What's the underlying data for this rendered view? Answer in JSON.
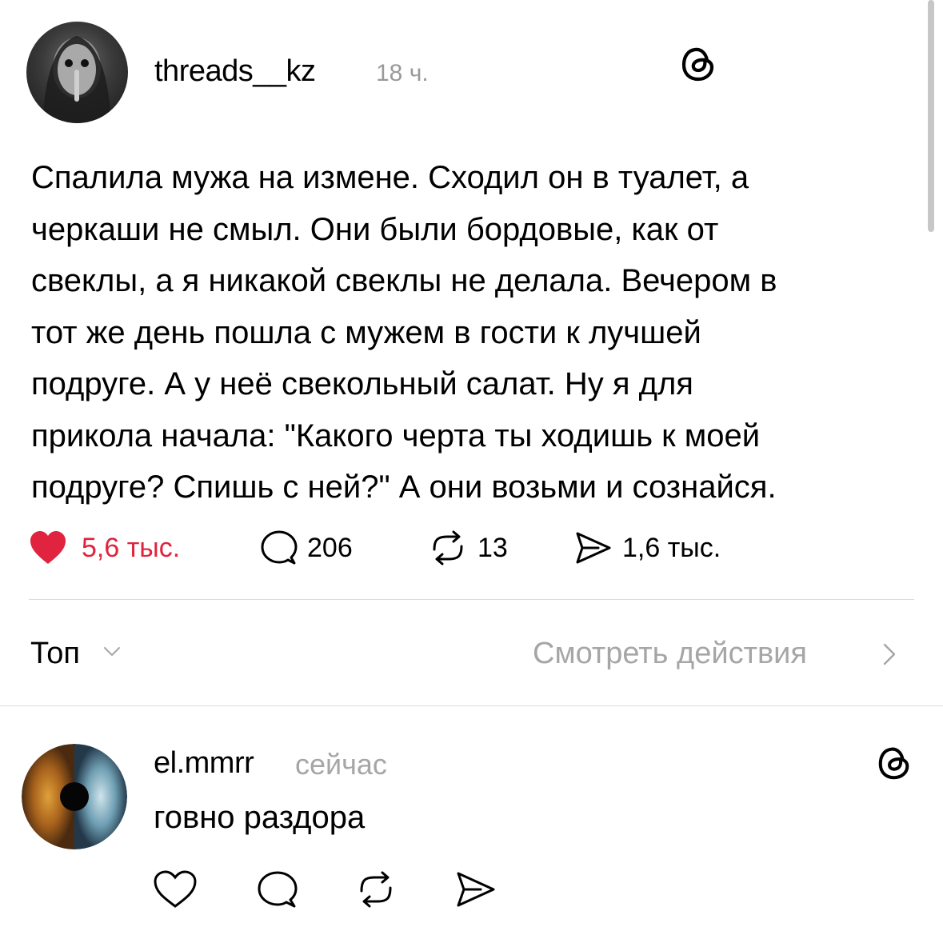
{
  "post": {
    "username": "threads__kz",
    "time": "18 ч.",
    "text": "Спалила мужа на измене. Сходил он в туалет, а\nчеркаши не смыл. Они были бордовые, как от\nсвеклы, а я никакой свеклы не делала. Вечером в\nтот же день пошла с мужем в гости к лучшей\nподруге. А у неё свекольный салат. Ну я для\nприкола начала: \"Какого черта ты ходишь к моей\nподруге? Спишь с ней?\" А они возьми и сознайся.",
    "likes": "5,6 тыс.",
    "replies": "206",
    "reposts": "13",
    "shares": "1,6 тыс.",
    "liked": true,
    "like_color": "#e0233e"
  },
  "sort": {
    "label": "Топ",
    "activity_link": "Смотреть действия"
  },
  "comment": {
    "username": "el.mmrr",
    "time": "сейчас",
    "text": "говно раздора"
  },
  "icons": {
    "threads": "threads-logo-icon",
    "heart": "heart-icon",
    "reply": "comment-bubble-icon",
    "repost": "repost-icon",
    "share": "send-icon"
  }
}
